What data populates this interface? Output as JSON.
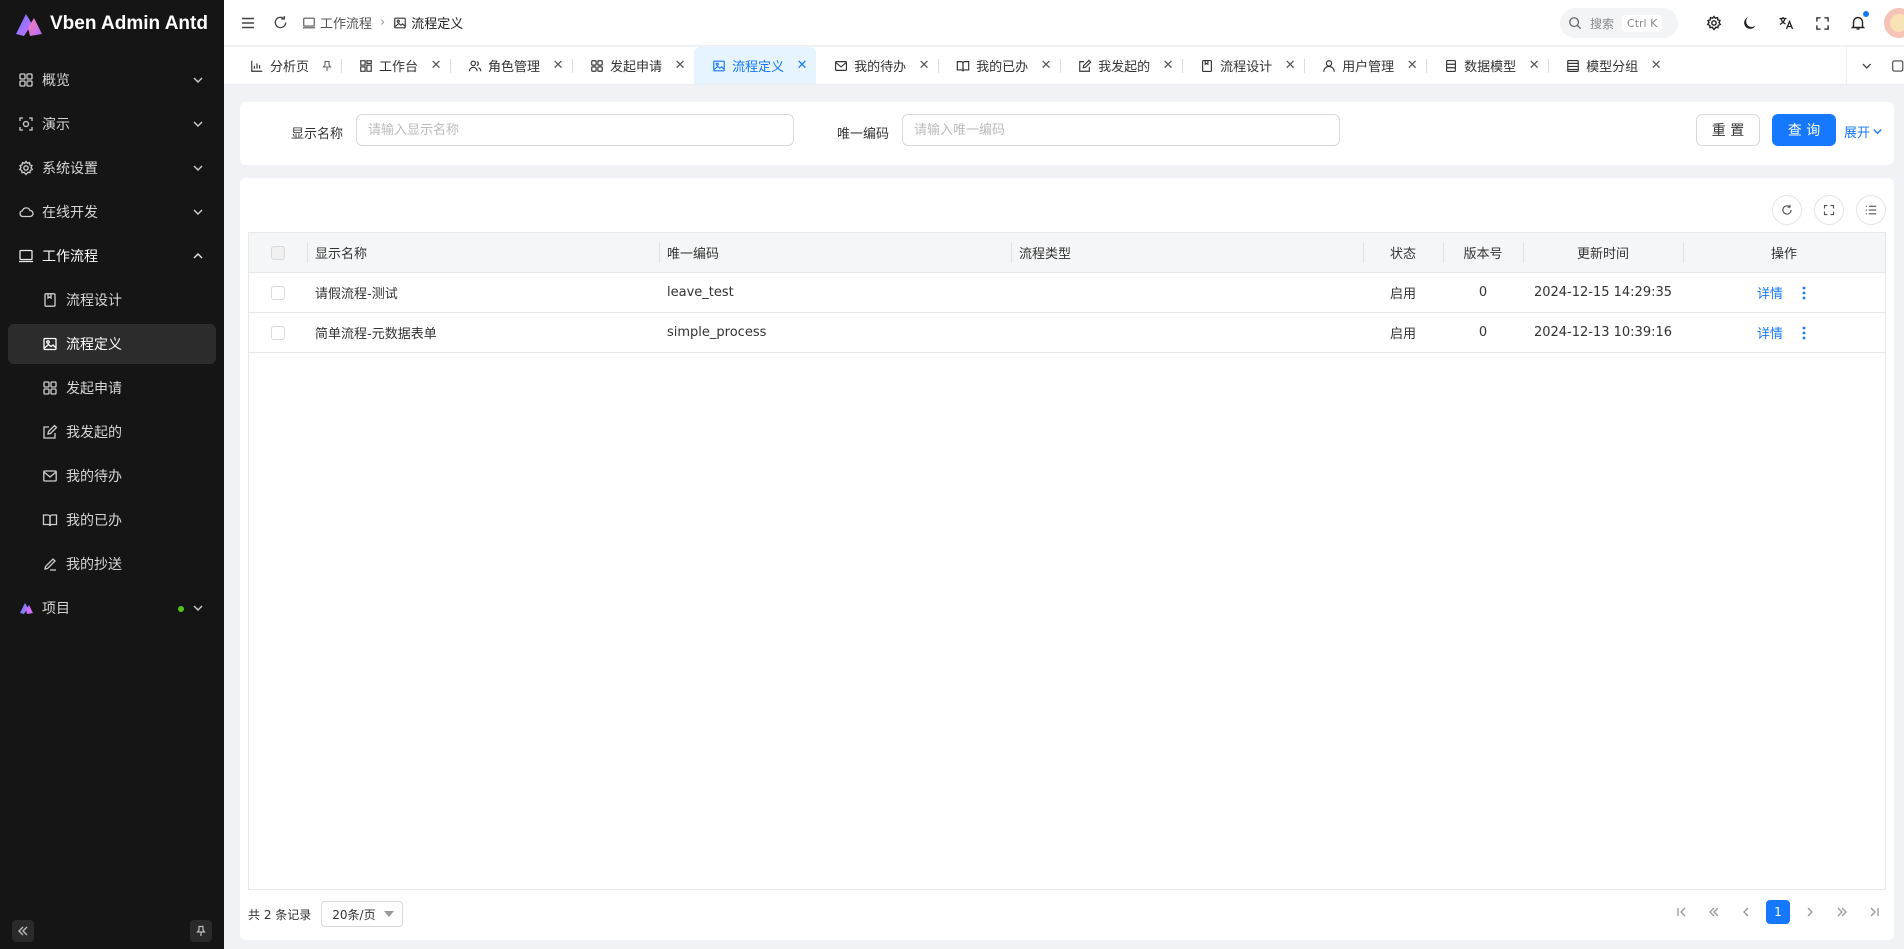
{
  "app": {
    "title": "Vben Admin Antd"
  },
  "sidebar": {
    "items": [
      {
        "label": "概览",
        "icon": "dashboard-icon"
      },
      {
        "label": "演示",
        "icon": "demo-icon"
      },
      {
        "label": "系统设置",
        "icon": "gear-icon"
      },
      {
        "label": "在线开发",
        "icon": "cloud-icon"
      },
      {
        "label": "工作流程",
        "icon": "monitor-icon"
      }
    ],
    "sub_items": [
      {
        "label": "流程设计",
        "icon": "document-icon"
      },
      {
        "label": "流程定义",
        "icon": "image-icon"
      },
      {
        "label": "发起申请",
        "icon": "apps-icon"
      },
      {
        "label": "我发起的",
        "icon": "edit-icon"
      },
      {
        "label": "我的待办",
        "icon": "mail-icon"
      },
      {
        "label": "我的已办",
        "icon": "book-icon"
      },
      {
        "label": "我的抄送",
        "icon": "pen-icon"
      }
    ],
    "project": {
      "label": "项目",
      "icon": "vben-logo-icon"
    }
  },
  "header": {
    "breadcrumb": [
      "工作流程",
      "流程定义"
    ],
    "search_placeholder": "搜索",
    "search_shortcut": "Ctrl K"
  },
  "tabs": [
    {
      "label": "分析页",
      "icon": "chart-icon",
      "pinned": true
    },
    {
      "label": "工作台",
      "icon": "workbench-icon"
    },
    {
      "label": "角色管理",
      "icon": "users-icon"
    },
    {
      "label": "发起申请",
      "icon": "apps-icon"
    },
    {
      "label": "流程定义",
      "icon": "image-icon",
      "active": true
    },
    {
      "label": "我的待办",
      "icon": "mail-icon"
    },
    {
      "label": "我的已办",
      "icon": "book-icon"
    },
    {
      "label": "我发起的",
      "icon": "edit-icon"
    },
    {
      "label": "流程设计",
      "icon": "document-icon"
    },
    {
      "label": "用户管理",
      "icon": "user-icon"
    },
    {
      "label": "数据模型",
      "icon": "database-icon"
    },
    {
      "label": "模型分组",
      "icon": "group-icon"
    }
  ],
  "filter": {
    "name_label": "显示名称",
    "name_placeholder": "请输入显示名称",
    "code_label": "唯一编码",
    "code_placeholder": "请输入唯一编码",
    "reset_label": "重 置",
    "query_label": "查 询",
    "expand_label": "展开"
  },
  "table": {
    "columns": [
      "显示名称",
      "唯一编码",
      "流程类型",
      "状态",
      "版本号",
      "更新时间",
      "操作"
    ],
    "rows": [
      {
        "name": "请假流程-测试",
        "code": "leave_test",
        "type": "",
        "status": "启用",
        "version": "0",
        "updated": "2024-12-15 14:29:35",
        "action": "详情"
      },
      {
        "name": "简单流程-元数据表单",
        "code": "simple_process",
        "type": "",
        "status": "启用",
        "version": "0",
        "updated": "2024-12-13 10:39:16",
        "action": "详情"
      }
    ]
  },
  "pagination": {
    "total_text": "共 2 条记录",
    "page_size": "20条/页",
    "current_page": "1"
  },
  "colors": {
    "primary": "#1677ff",
    "sidebar_bg": "#151515"
  }
}
